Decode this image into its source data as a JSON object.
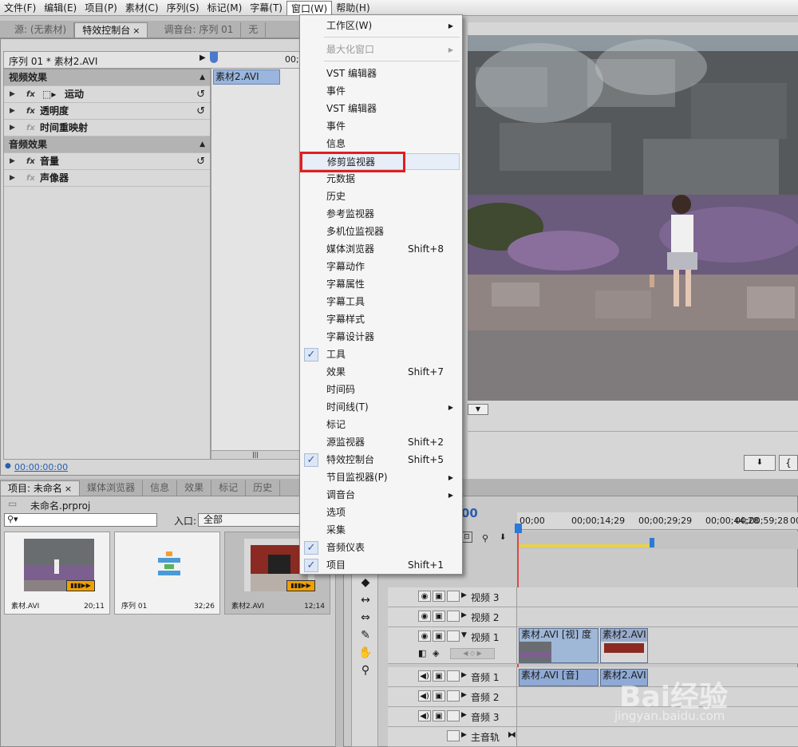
{
  "menubar": {
    "items": [
      "文件(F)",
      "编辑(E)",
      "项目(P)",
      "素材(C)",
      "序列(S)",
      "标记(M)",
      "字幕(T)",
      "窗口(W)",
      "帮助(H)"
    ],
    "active_index": 7
  },
  "source_tabs": {
    "source": "源: (无素材)",
    "effect_controls": "特效控制台",
    "mixer": "调音台: 序列 01",
    "truncated": "无"
  },
  "effect_controls": {
    "sequence_label": "序列 01 * 素材2.AVI",
    "timecode_head": "00;0",
    "clip_label": "素材2.AVI",
    "video_effects": "视频效果",
    "motion": "运动",
    "opacity": "透明度",
    "time_remap": "时间重映射",
    "audio_effects": "音频效果",
    "volume": "音量",
    "panner": "声像器",
    "timecode": "00:00:00:00"
  },
  "project_tabs": {
    "project": "项目: 未命名",
    "media_browser": "媒体浏览器",
    "info": "信息",
    "effects": "效果",
    "markers": "标记",
    "history": "历史"
  },
  "project": {
    "file": "未命名.prproj",
    "search_placeholder": "",
    "in_label": "入口:",
    "in_value": "全部",
    "items": [
      {
        "name": "素材.AVI",
        "duration": "20;11"
      },
      {
        "name": "序列 01",
        "duration": "32;26"
      },
      {
        "name": "素材2.AVI",
        "duration": "12;14"
      }
    ]
  },
  "timeline": {
    "timecode_partial": "00",
    "ruler": [
      "00;00",
      "00;00;14;29",
      "00;00;29;29",
      "00;00;44;28",
      "00;00;59;28",
      "00"
    ],
    "tracks": {
      "video3": "视频 3",
      "video2": "视频 2",
      "video1": "视频 1",
      "audio1": "音频 1",
      "audio2": "音频 2",
      "audio3": "音频 3",
      "master": "主音轨"
    },
    "clips": {
      "v1_a": "素材.AVI [视] 度",
      "v1_b": "素材2.AVI",
      "a1_a": "素材.AVI [音]",
      "a1_b": "素材2.AVI"
    }
  },
  "window_menu": {
    "items": [
      {
        "label": "工作区(W)",
        "sub": true
      },
      {
        "label": "最大化窗口",
        "sub": true,
        "disabled": true
      },
      {
        "label": "VST 编辑器"
      },
      {
        "label": "事件"
      },
      {
        "label": "VST 编辑器"
      },
      {
        "label": "事件"
      },
      {
        "label": "信息"
      },
      {
        "label": "修剪监视器",
        "hover": true
      },
      {
        "label": "元数据"
      },
      {
        "label": "历史"
      },
      {
        "label": "参考监视器"
      },
      {
        "label": "多机位监视器"
      },
      {
        "label": "媒体浏览器",
        "shortcut": "Shift+8"
      },
      {
        "label": "字幕动作"
      },
      {
        "label": "字幕属性"
      },
      {
        "label": "字幕工具"
      },
      {
        "label": "字幕样式"
      },
      {
        "label": "字幕设计器"
      },
      {
        "label": "工具",
        "checked": true
      },
      {
        "label": "效果",
        "shortcut": "Shift+7"
      },
      {
        "label": "时间码"
      },
      {
        "label": "时间线(T)",
        "sub": true
      },
      {
        "label": "标记"
      },
      {
        "label": "源监视器",
        "shortcut": "Shift+2"
      },
      {
        "label": "特效控制台",
        "shortcut": "Shift+5",
        "checked": true
      },
      {
        "label": "节目监视器(P)",
        "sub": true
      },
      {
        "label": "调音台",
        "sub": true
      },
      {
        "label": "选项"
      },
      {
        "label": "采集"
      },
      {
        "label": "音频仪表",
        "checked": true
      },
      {
        "label": "项目",
        "shortcut": "Shift+1",
        "checked": true
      }
    ]
  },
  "watermark": {
    "brand": "Bai经验",
    "url": "jingyan.baidu.com"
  }
}
